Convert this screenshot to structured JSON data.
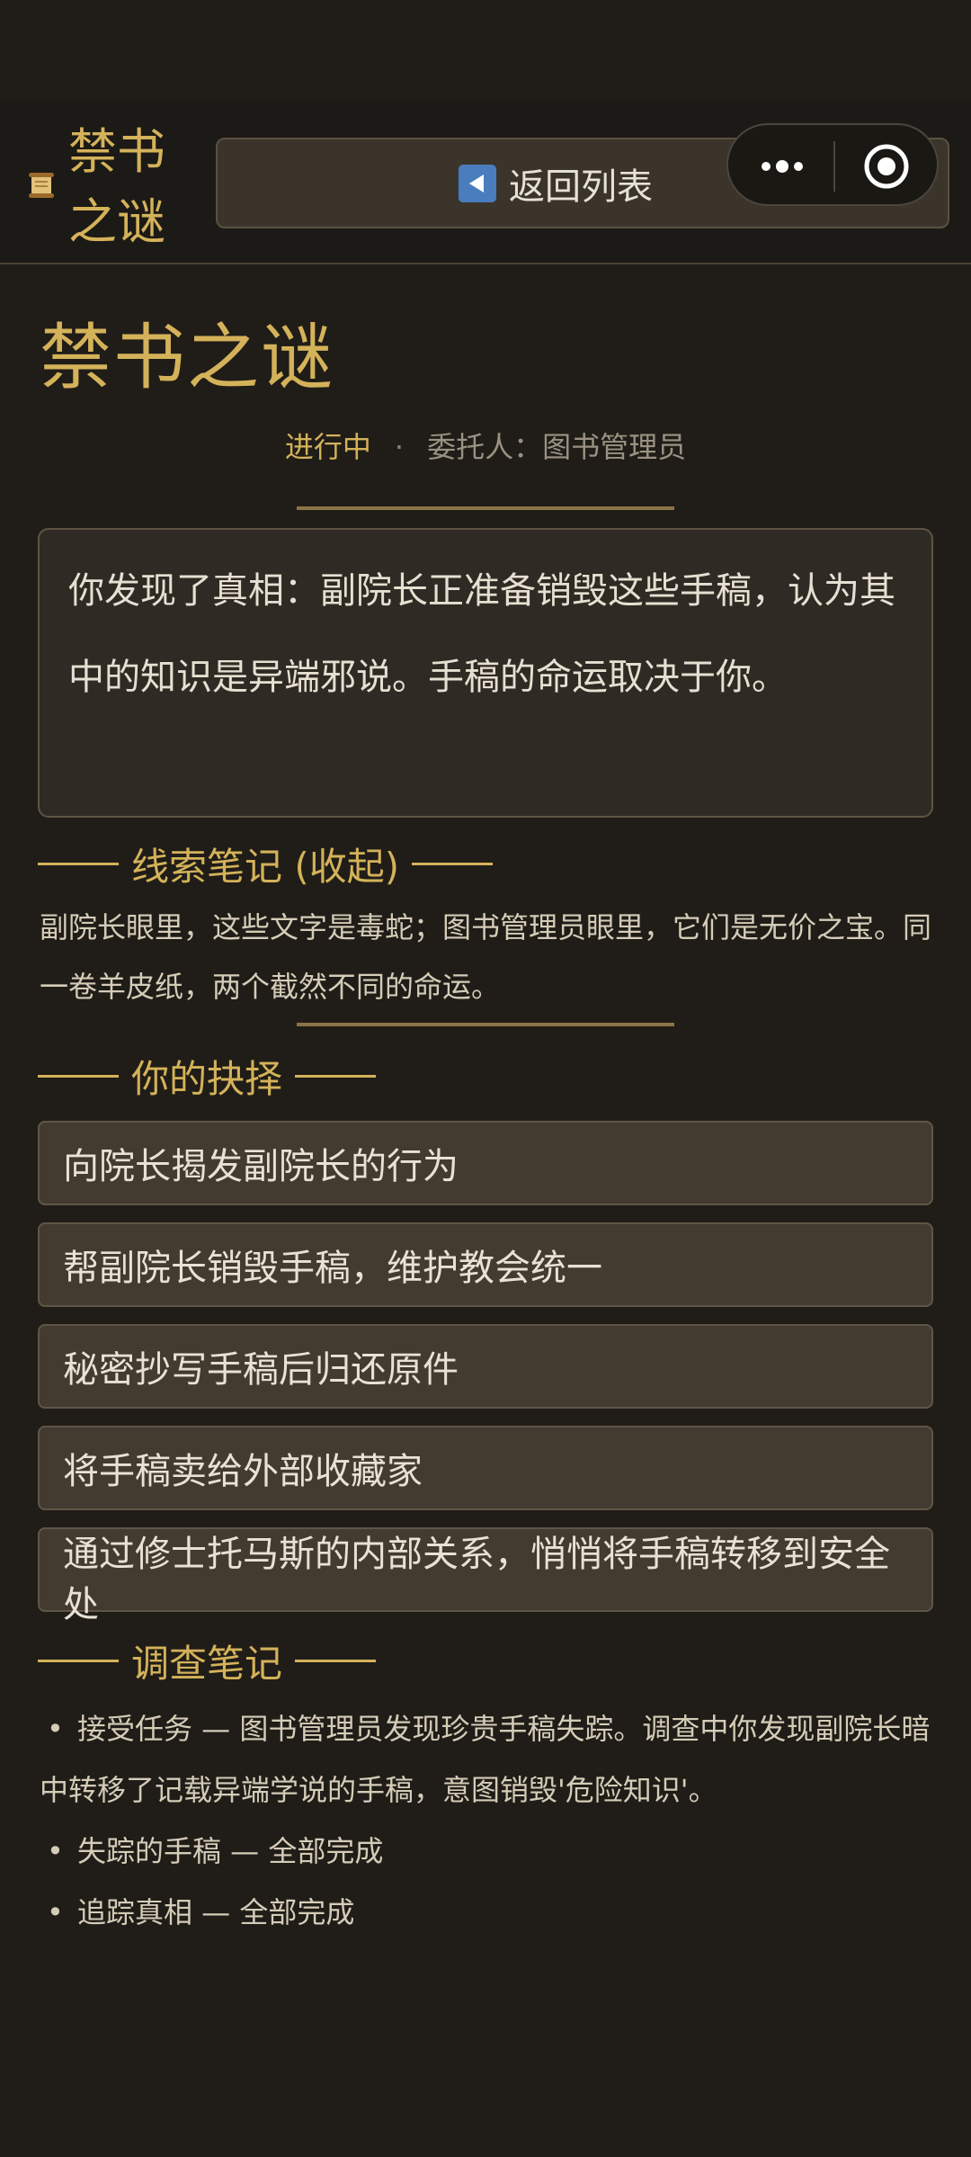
{
  "nav": {
    "title": "禁书之谜",
    "back_label": "返回列表"
  },
  "quest": {
    "title": "禁书之谜",
    "status": "进行中",
    "client": "委托人：图书管理员",
    "story": "你发现了真相：副院长正准备销毁这些手稿，认为其中的知识是异端邪说。手稿的命运取决于你。"
  },
  "clue": {
    "heading": "线索笔记 (收起)",
    "text": "副院长眼里，这些文字是毒蛇；图书管理员眼里，它们是无价之宝。同一卷羊皮纸，两个截然不同的命运。"
  },
  "choices": {
    "heading": "你的抉择",
    "items": [
      "向院长揭发副院长的行为",
      "帮副院长销毁手稿，维护教会统一",
      "秘密抄写手稿后归还原件",
      "将手稿卖给外部收藏家",
      "通过修士托马斯的内部关系，悄悄将手稿转移到安全处"
    ]
  },
  "investigation": {
    "heading": "调查笔记",
    "items": [
      "接受任务 — 图书管理员发现珍贵手稿失踪。调查中你发现副院长暗中转移了记载异端学说的手稿，意图销毁'危险知识'。",
      "失踪的手稿 — 全部完成",
      "追踪真相 — 全部完成"
    ]
  },
  "colors": {
    "accent": "#d4b25a",
    "background": "#201d18",
    "card": "#433a30"
  },
  "icons": [
    "scroll-icon",
    "back-arrow-icon",
    "more-dots-icon",
    "close-target-icon"
  ]
}
